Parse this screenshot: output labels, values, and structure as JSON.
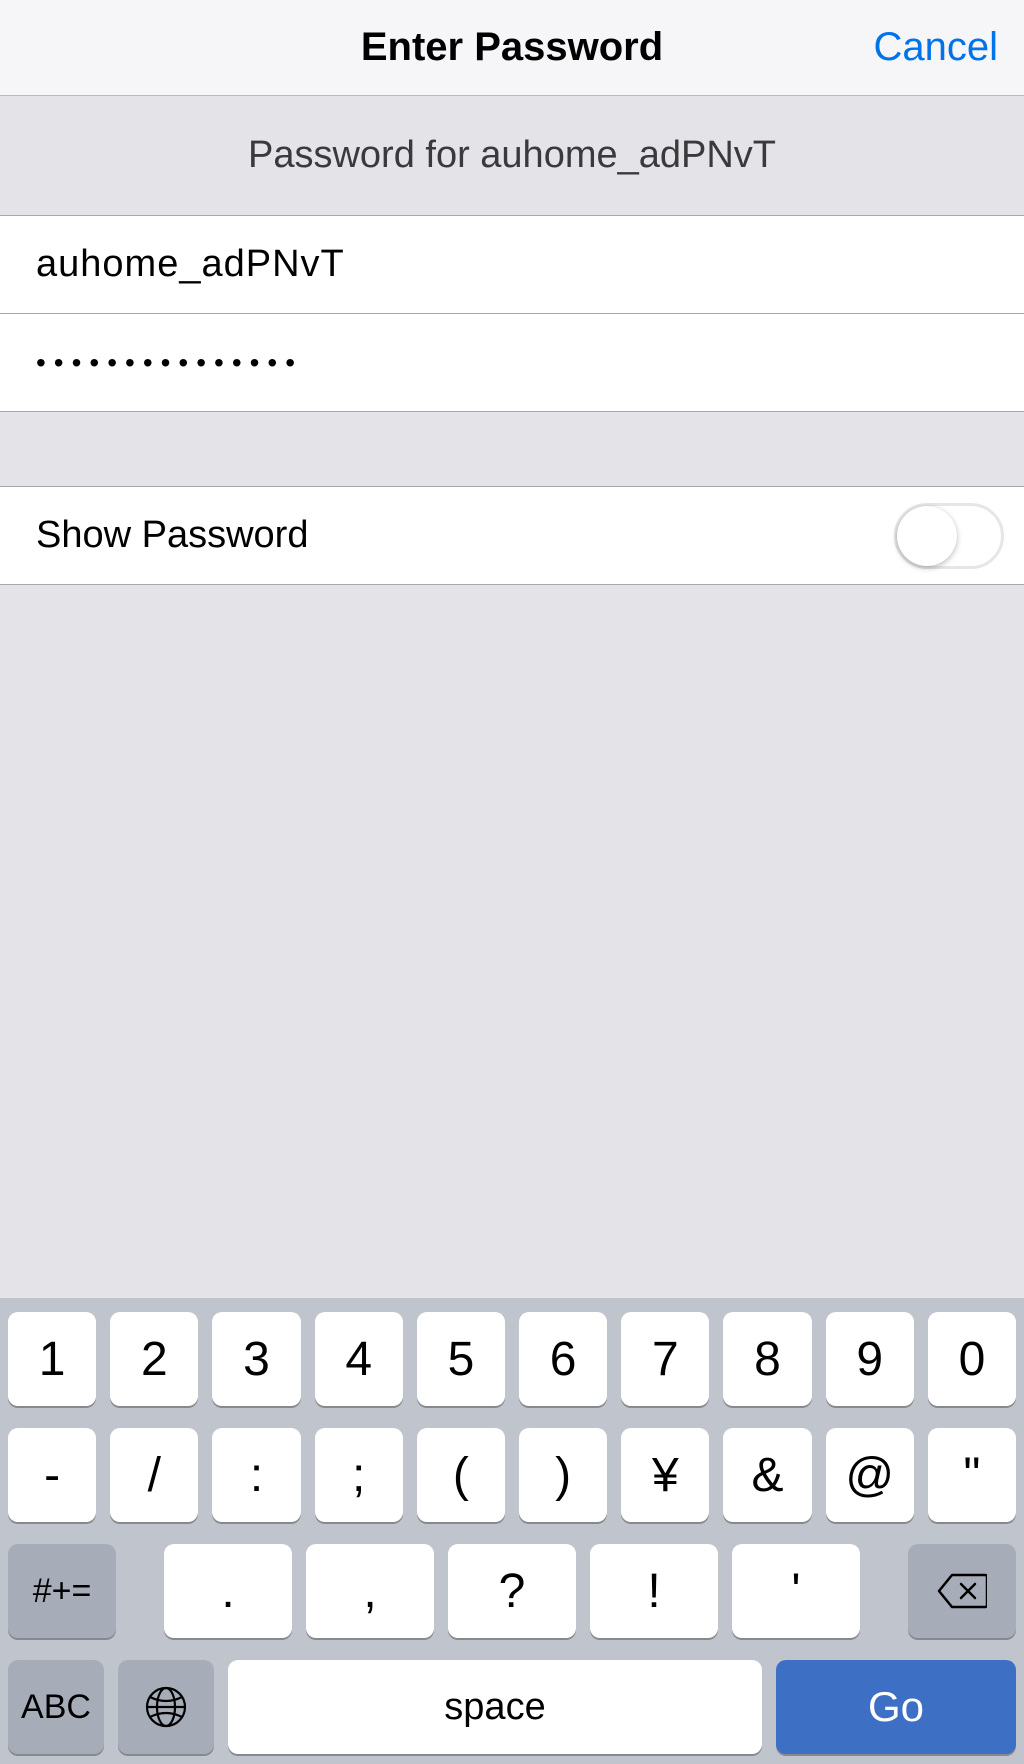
{
  "navbar": {
    "title": "Enter Password",
    "cancel": "Cancel"
  },
  "section_header": "Password for auhome_adPNvT",
  "fields": {
    "username": "auhome_adPNvT",
    "password": "•••••••••••••••"
  },
  "show_password": {
    "label": "Show Password",
    "on": false
  },
  "keyboard": {
    "row1": [
      "1",
      "2",
      "3",
      "4",
      "5",
      "6",
      "7",
      "8",
      "9",
      "0"
    ],
    "row2": [
      "-",
      "/",
      ":",
      ";",
      "(",
      ")",
      "¥",
      "&",
      "@",
      "\""
    ],
    "row3": {
      "shift": "#+=",
      "punct": [
        ".",
        ",",
        "?",
        "!",
        "'"
      ],
      "backspace": "⌫"
    },
    "row4": {
      "abc": "ABC",
      "space": "space",
      "go": "Go"
    }
  }
}
